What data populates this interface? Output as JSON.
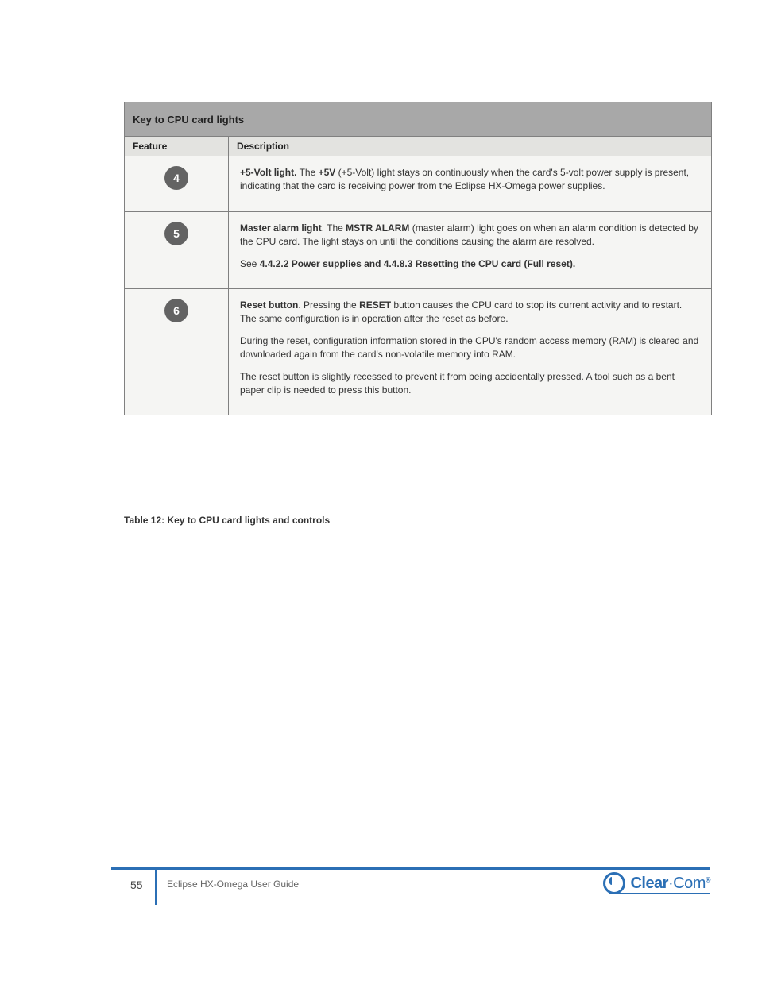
{
  "table": {
    "title": "Key to CPU card lights",
    "header_feature": "Feature",
    "header_desc": "Description",
    "rows": [
      {
        "num": "4",
        "desc": [
          "<b>+5-Volt light.</b> The <b>+5V</b> (+5-Volt) light stays on continuously when the card's 5-volt power supply is present, indicating that the card is receiving power from the Eclipse HX-Omega power supplies."
        ]
      },
      {
        "num": "5",
        "desc": [
          "<b>Master alarm light</b>. The <b>MSTR ALARM</b> (master alarm) light goes on when an alarm condition is detected by the CPU card. The light stays on until the conditions causing the alarm are resolved.",
          "See <b>4.4.2.2 Power supplies and 4.4.8.3 Resetting the CPU card (Full reset).</b>"
        ]
      },
      {
        "num": "6",
        "desc": [
          "<b>Reset button</b>. Pressing the <b>RESET</b> button causes the CPU card to stop its current activity and to restart. The same configuration is in operation after the reset as before.",
          "During the reset, configuration information stored in the CPU's random access memory (RAM) is cleared and downloaded again from the card's non-volatile memory into RAM.",
          "The reset button is slightly recessed  to prevent it from being accidentally pressed. A tool such as a bent paper clip is needed to press this button."
        ]
      }
    ]
  },
  "caption": "Table 12: Key to CPU card lights and controls",
  "footer": {
    "page": "55",
    "doc": "Eclipse HX-Omega User Guide"
  },
  "brand": {
    "name_a": "Clear",
    "name_b": "·Com"
  }
}
